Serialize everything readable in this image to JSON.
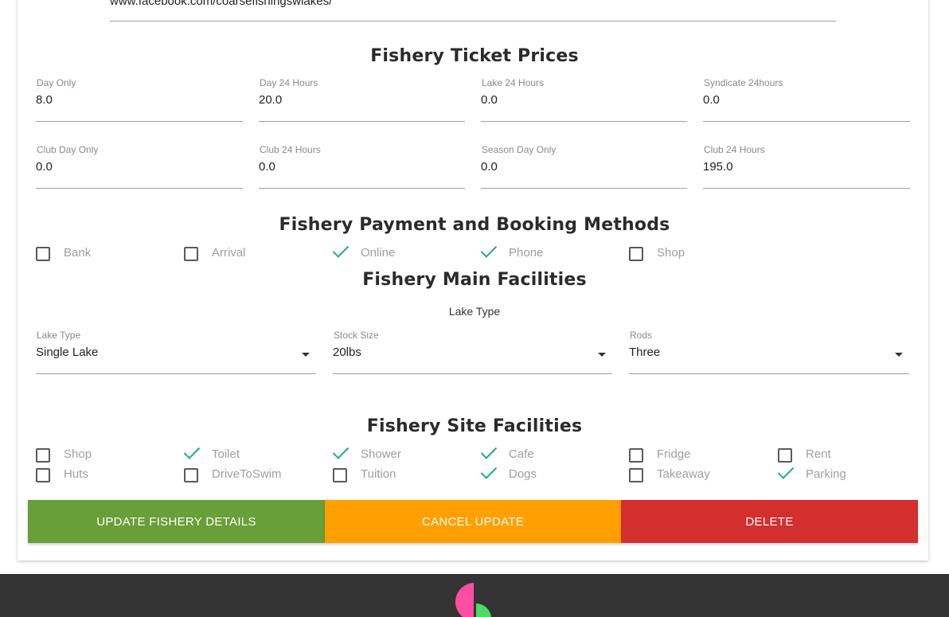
{
  "facebook_url": "www.facebook.com/coarsefishingswlakes/",
  "ticket_prices": {
    "title": "Fishery Ticket Prices",
    "fields": [
      {
        "label": "Day Only",
        "value": "8.0"
      },
      {
        "label": "Day 24 Hours",
        "value": "20.0"
      },
      {
        "label": "Lake 24 Hours",
        "value": "0.0"
      },
      {
        "label": "Syndicate 24hours",
        "value": "0.0"
      },
      {
        "label": "Club Day Only",
        "value": "0.0"
      },
      {
        "label": "Club 24 Hours",
        "value": "0.0"
      },
      {
        "label": "Season Day Only",
        "value": "0.0"
      },
      {
        "label": "Club 24 Hours",
        "value": "195.0"
      }
    ]
  },
  "payment": {
    "title": "Fishery Payment and Booking Methods",
    "options": [
      {
        "label": "Bank",
        "checked": false
      },
      {
        "label": "Arrival",
        "checked": false
      },
      {
        "label": "Online",
        "checked": true
      },
      {
        "label": "Phone",
        "checked": true
      },
      {
        "label": "Shop",
        "checked": false
      }
    ]
  },
  "main_facilities": {
    "title": "Fishery Main Facilities",
    "subtitle": "Lake Type",
    "selects": [
      {
        "label": "Lake Type",
        "value": "Single Lake"
      },
      {
        "label": "Stock Size",
        "value": "20lbs"
      },
      {
        "label": "Rods",
        "value": "Three"
      }
    ]
  },
  "site_facilities": {
    "title": "Fishery Site Facilities",
    "options": [
      {
        "label": "Shop",
        "checked": false
      },
      {
        "label": "Toilet",
        "checked": true
      },
      {
        "label": "Shower",
        "checked": true
      },
      {
        "label": "Cafe",
        "checked": true
      },
      {
        "label": "Fridge",
        "checked": false
      },
      {
        "label": "Rent",
        "checked": false
      },
      {
        "label": "Huts",
        "checked": false
      },
      {
        "label": "DriveToSwim",
        "checked": false
      },
      {
        "label": "Tuition",
        "checked": false
      },
      {
        "label": "Dogs",
        "checked": true
      },
      {
        "label": "Takeaway",
        "checked": false
      },
      {
        "label": "Parking",
        "checked": true
      }
    ]
  },
  "buttons": {
    "update": "UPDATE FISHERY DETAILS",
    "cancel": "CANCEL UPDATE",
    "delete": "DELETE"
  },
  "colors": {
    "update": "#689f38",
    "cancel": "#ffa000",
    "delete": "#d32f2f",
    "check": "#26a69a",
    "footer": "#333333",
    "logo_pink": "#ff4fa3",
    "logo_green": "#4cd964"
  }
}
